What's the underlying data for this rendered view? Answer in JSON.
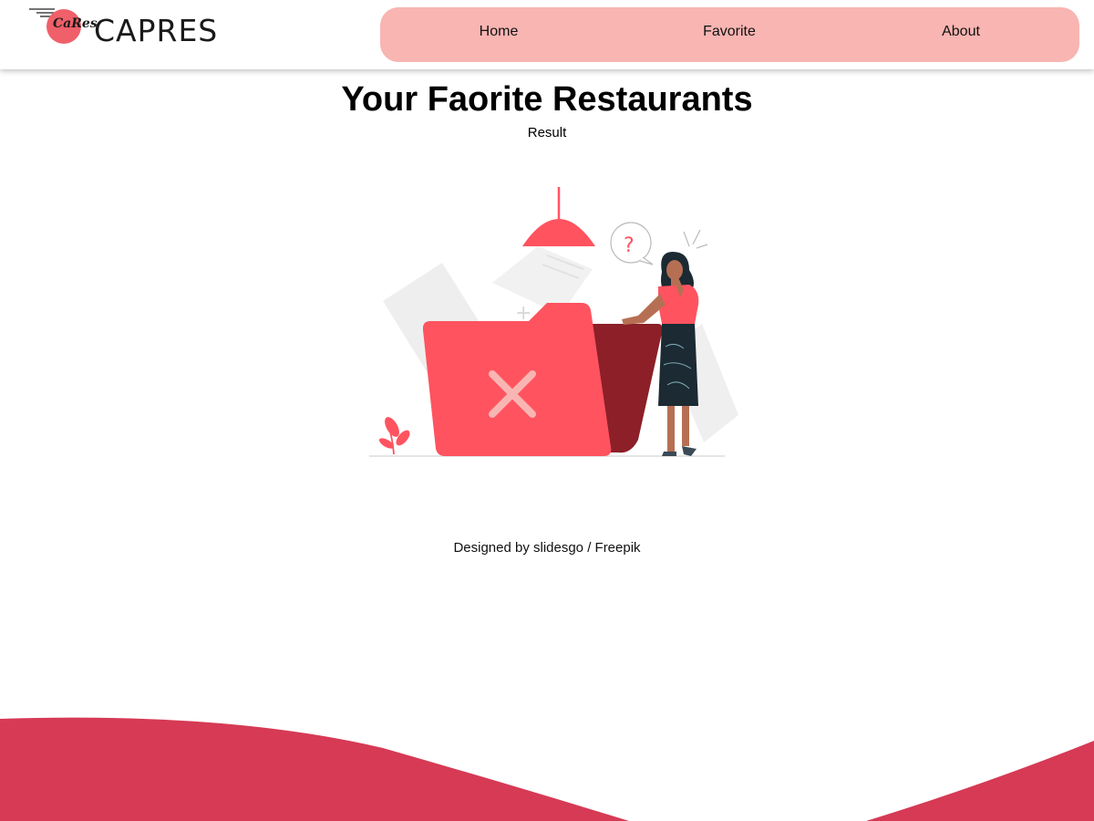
{
  "brand": {
    "logo_script": "CaRes",
    "name": "CAPRES",
    "accent": "#f0606a"
  },
  "nav": {
    "background": "#f8b5b2",
    "items": [
      {
        "label": "Home"
      },
      {
        "label": "Favorite"
      },
      {
        "label": "About"
      }
    ]
  },
  "main": {
    "title": "Your Faorite Restaurants",
    "subtitle": "Result",
    "illustration": "empty-folder-illustration"
  },
  "footer": {
    "credit": "Designed by slidesgo / Freepik",
    "wave_color": "#d63a55"
  }
}
